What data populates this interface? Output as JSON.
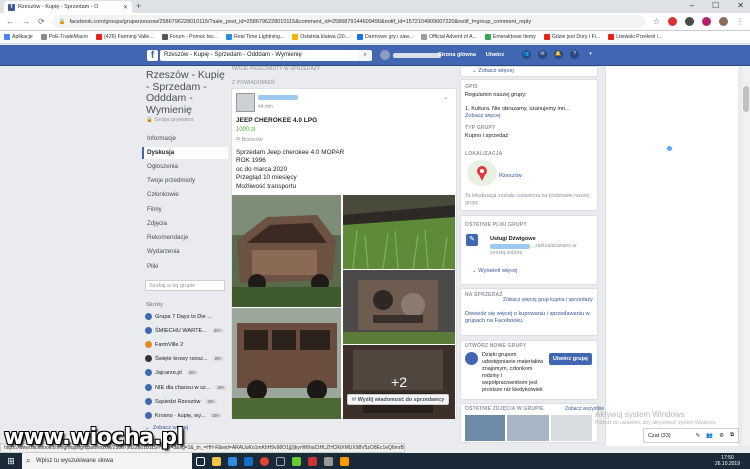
{
  "browser": {
    "tab_title": "Rzeszów - Kupię - Sprzedam - O",
    "new_tab": "+",
    "url": "facebook.com/groups/gruparzeszow/2586796228010115/?sale_post_id=2586796228010115&comment_id=2586879144609490&notif_id=1572104909007220&notif_t=group_comment_reply",
    "bookmarks": [
      "Aplikacje",
      "PoE-TradeMacro",
      "(426) Farming Valle...",
      "Forum - Pomoc tec...",
      "Real Time Lightning...",
      "Ostatnia klatwa (20...",
      "Darmowe gry i zaw...",
      "Official Advent of A...",
      "Emeraldowe Itemy",
      "Gdzie jest Dory / Fi...",
      "Litewski Przekret /..."
    ]
  },
  "fb": {
    "search_value": "Rzeszów - Kupię - Sprzedam - Odddam - Wymienię",
    "nav": [
      "Strona główna",
      "Utwórz"
    ]
  },
  "group": {
    "title": "Rzeszów - Kupię - Sprzedam - Odddam - Wymienię",
    "privacy": "Grupa prywatna",
    "nav": [
      "Informacje",
      "Dyskusja",
      "Ogłoszenia",
      "Twoje przedmioty",
      "Członkowie",
      "Filmy",
      "Zdjęcia",
      "Rekomendacje",
      "Wydarzenia",
      "Pliki"
    ],
    "search_placeholder": "Szukaj w tej grupie",
    "shortcuts_label": "Skróty",
    "shortcuts": [
      {
        "name": "Grupa 7 Days to Die ...",
        "badge": ""
      },
      {
        "name": "ŚMIECHU WARTE...",
        "badge": "20+"
      },
      {
        "name": "FarmVille 2",
        "badge": ""
      },
      {
        "name": "Święte krowy rzesz...",
        "badge": "20+"
      },
      {
        "name": "Jajcarze.pl",
        "badge": "20+"
      },
      {
        "name": "NIE dla chaosu w sz...",
        "badge": "20+"
      },
      {
        "name": "Sąsiedzi Rzeszów",
        "badge": "20+"
      },
      {
        "name": "Krosno · kupię, wy...",
        "badge": "20+"
      },
      {
        "name": "Zobacz więcej",
        "badge": ""
      }
    ]
  },
  "post": {
    "top_label": "TWOJE PRZEDMIOTY W SPRZEDAŻY",
    "from_label": "Z POWIADOMIEŃ",
    "time": "44 min",
    "title": "JEEP CHEROKEE 4.0 LPG",
    "price": "1000 zł",
    "location": "Brzozów",
    "body": "Sprzedam Jeep cherokee 4.0 MOPAR\nROK 1996\noc do marca 2020\nPrzegląd 10 miesięcy\nMożliwość transportu",
    "more_photos": "+2",
    "message_button": "Wyślij wiadomość do sprzedawcy"
  },
  "right": {
    "see_more": "Zobacz więcej",
    "opis_hdr": "OPIS",
    "opis_text": "Regulamin naszej grupy:",
    "rule": "1. Kultura. Nie obrazamy, szanujemy inn...",
    "opis_more": "Zobacz więcej",
    "type_hdr": "TYP GRUPY",
    "type_text": "Kupno i sprzedaż",
    "loc_hdr": "LOKALIZACJA",
    "loc_city": "Rzeszów",
    "loc_note": "Ta lokalizacja została ustawiona na podstawie nazwy grupy",
    "files_hdr": "OSTATNIE PLIKI GRUPY",
    "file_name": "Usługi Dźwigowe",
    "file_meta": ", zaktualizowano w zeszłą sobotę",
    "files_more": "Wyświetl więcej",
    "sale_hdr": "NA SPRZEDAŻ",
    "sale_link": "Zobacz więcej grup kupna i sprzedaży",
    "sale_text": "Dowiedz się więcej o kupowaniu i sprzedawaniu w grupach na Facebooku.",
    "create_hdr": "UTWÓRZ NOWE GRUPY",
    "create_text": "Dzięki grupom udostępnianie materiałów znajomym, członkom rodziny i współpracownikom jest prostsze niż kiedykolwiek",
    "create_btn": "Utwórz grupę",
    "photos_hdr": "OSTATNIE ZDJĘCIA W GRUPIE",
    "photos_more": "Zobacz wszystkie"
  },
  "sidebar": {
    "activate_title": "Aktywuj system Windows",
    "activate_sub": "Przejdź do ustawień, aby aktywować system Windows.",
    "chat": "Czat (33)"
  },
  "status_url": "https://www.facebook.com/groups/gruparzeszow/2586796228010115/?type=3&ifg=1&_tn_=HH-R&eid=ARAUuKo1mKhH9v98O1jj2jkyrW6haCtHLZHCRtXMUX98V5zO8Ec1eQ6mrBom2gwUMnvrtgJDPl6Kx",
  "watermark": "www.wiocha.pl",
  "taskbar": {
    "search": "Wpisz tu wyszukiwane słowa",
    "time": "17:50",
    "date": "26.10.2019"
  }
}
